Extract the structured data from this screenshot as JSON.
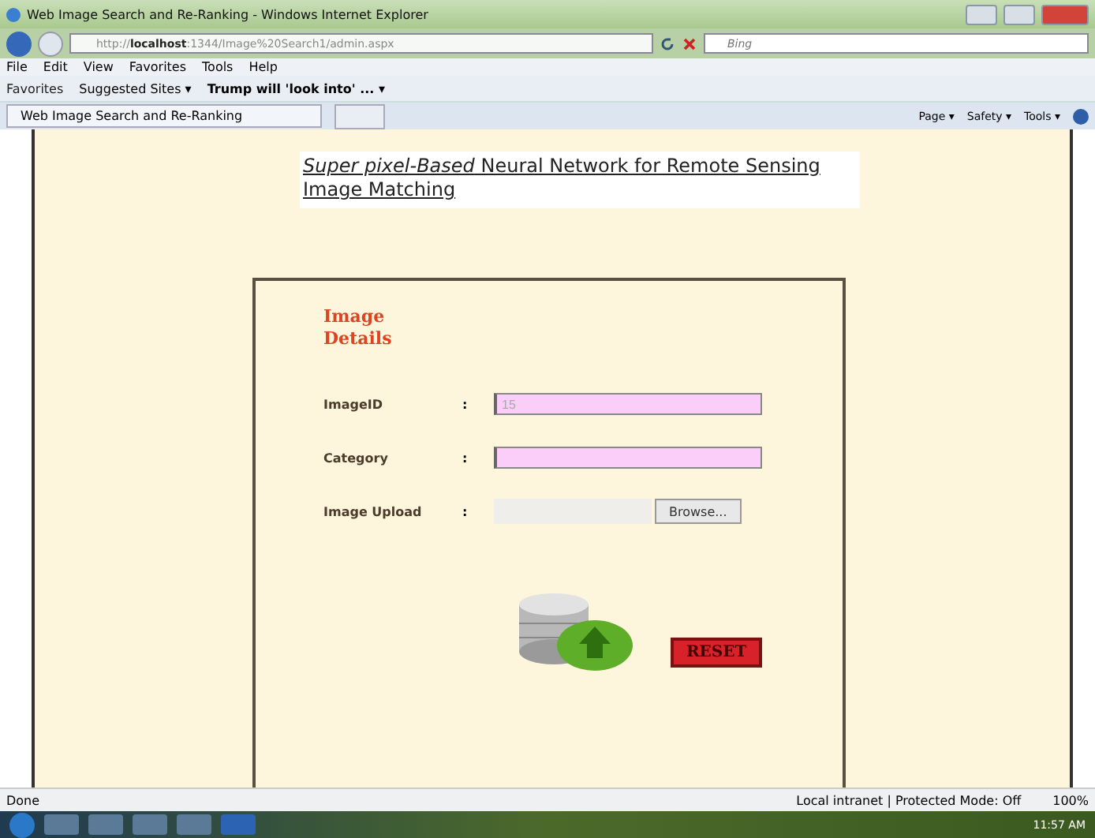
{
  "window": {
    "title": "Web Image Search and Re-Ranking - Windows Internet Explorer"
  },
  "address_bar": {
    "url_prefix": "http://",
    "url_host": "localhost",
    "url_rest": ":1344/Image%20Search1/admin.aspx"
  },
  "search": {
    "placeholder": "Bing"
  },
  "menu": [
    "File",
    "Edit",
    "View",
    "Favorites",
    "Tools",
    "Help"
  ],
  "favorites_bar": {
    "favorites": "Favorites",
    "items": [
      {
        "label": "Suggested Sites ▾",
        "bold": false
      },
      {
        "label": "Trump will 'look into' ... ▾",
        "bold": true
      }
    ]
  },
  "tab": {
    "title": "Web Image Search and Re-Ranking"
  },
  "command_bar": [
    "Page ▾",
    "Safety ▾",
    "Tools ▾"
  ],
  "page": {
    "heading": "*Super pixel-Based* Neural Network for Remote Sensing Image Matching",
    "form": {
      "title": "Image Details",
      "fields": [
        {
          "label": "ImageID",
          "separator": ":",
          "kind": "text",
          "value": "15"
        },
        {
          "label": "Category",
          "separator": ":",
          "kind": "text"
        },
        {
          "label": "Image Upload",
          "separator": ":",
          "kind": "file",
          "button": "Browse..."
        }
      ],
      "reset": "RESET"
    }
  },
  "status_bar": {
    "text": "Done",
    "zone": "Local intranet | Protected Mode: Off",
    "zoom": "100%"
  },
  "taskbar": {
    "clock": "11:57 AM"
  }
}
